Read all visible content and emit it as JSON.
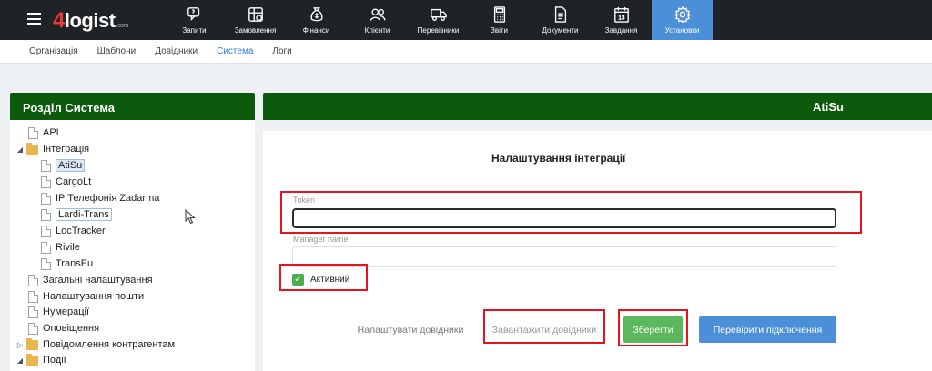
{
  "header": {
    "logo_main": "logist",
    "logo_num": "4",
    "logo_suffix": ".com",
    "nav": [
      {
        "label": "Запити",
        "icon": "requests-icon"
      },
      {
        "label": "Замовлення",
        "icon": "orders-icon"
      },
      {
        "label": "Фінанси",
        "icon": "finance-icon"
      },
      {
        "label": "Клієнти",
        "icon": "clients-icon"
      },
      {
        "label": "Перевізники",
        "icon": "truck-icon"
      },
      {
        "label": "Звіти",
        "icon": "calculator-icon"
      },
      {
        "label": "Документи",
        "icon": "document-icon"
      },
      {
        "label": "Завдання",
        "icon": "calendar-icon"
      },
      {
        "label": "Установки",
        "icon": "gear-icon"
      }
    ],
    "active_nav": "Установки"
  },
  "submenu": {
    "items": [
      "Організація",
      "Шаблони",
      "Довідники",
      "Система",
      "Логи"
    ],
    "active": "Система"
  },
  "sidebar": {
    "title": "Розділ Система",
    "tree": [
      {
        "label": "API",
        "type": "doc"
      },
      {
        "label": "Інтеграція",
        "type": "folder",
        "expanded": true
      },
      {
        "label": "AtiSu",
        "type": "doc",
        "selected": true
      },
      {
        "label": "CargoLt",
        "type": "doc"
      },
      {
        "label": "IP Телефонія Zadarma",
        "type": "doc"
      },
      {
        "label": "Lardi-Trans",
        "type": "doc",
        "highlighted": true
      },
      {
        "label": "LocTracker",
        "type": "doc"
      },
      {
        "label": "Rivile",
        "type": "doc"
      },
      {
        "label": "TransEu",
        "type": "doc"
      },
      {
        "label": "Загальні налаштування",
        "type": "doc"
      },
      {
        "label": "Налаштування пошти",
        "type": "doc"
      },
      {
        "label": "Нумерації",
        "type": "doc"
      },
      {
        "label": "Оповіщення",
        "type": "doc"
      },
      {
        "label": "Повідомлення контрагентам",
        "type": "folder",
        "expanded": false
      },
      {
        "label": "Події",
        "type": "folder",
        "expanded": true
      }
    ]
  },
  "main": {
    "header_title": "AtiSu",
    "card_title": "Налаштування інтеграції",
    "token": {
      "label": "Token",
      "value": ""
    },
    "manager_name": {
      "label": "Manager name",
      "value": ""
    },
    "active_checkbox": {
      "label": "Активний",
      "checked": true
    },
    "buttons": {
      "setup_dicts": "Налаштувати довідники",
      "load_dicts": "Завантажити довідники",
      "save": "Зберегти",
      "check_connection": "Перевірити підключення"
    }
  },
  "colors": {
    "topbar": "#1f2326",
    "active_tab": "#4a8fd8",
    "panel_header": "#0c5a0c",
    "annotation_red": "#e8141c",
    "save_green": "#5cb85c",
    "check_blue": "#4a8fd8"
  }
}
